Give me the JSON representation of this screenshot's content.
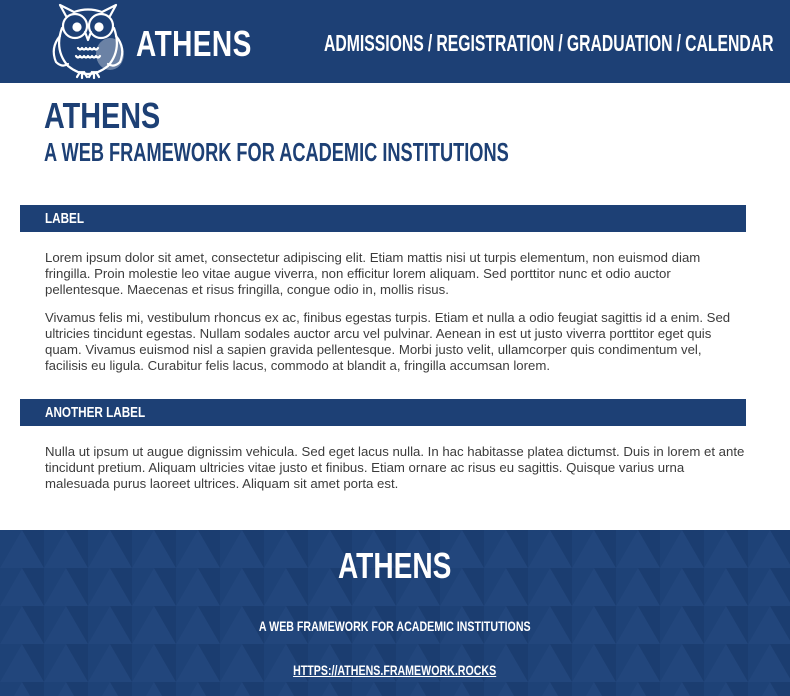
{
  "header": {
    "brand": "ATHENS",
    "nav": [
      {
        "label": "ADMISSIONS"
      },
      {
        "label": "REGISTRATION"
      },
      {
        "label": "GRADUATION"
      },
      {
        "label": "CALENDAR"
      }
    ],
    "nav_separator": "/"
  },
  "hero": {
    "title": "ATHENS",
    "subtitle": "A WEB FRAMEWORK FOR ACADEMIC INSTITUTIONS"
  },
  "sections": [
    {
      "label": "LABEL",
      "paragraphs": [
        "Lorem ipsum dolor sit amet, consectetur adipiscing elit. Etiam mattis nisi ut turpis elementum, non euismod diam fringilla. Proin molestie leo vitae augue viverra, non efficitur lorem aliquam. Sed porttitor nunc et odio auctor pellentesque. Maecenas et risus fringilla, congue odio in, mollis risus.",
        "Vivamus felis mi, vestibulum rhoncus ex ac, finibus egestas turpis. Etiam et nulla a odio feugiat sagittis id a enim. Sed ultricies tincidunt egestas. Nullam sodales auctor arcu vel pulvinar. Aenean in est ut justo viverra porttitor eget quis quam. Vivamus euismod nisl a sapien gravida pellentesque. Morbi justo velit, ullamcorper quis condimentum vel, facilisis eu ligula. Curabitur felis lacus, commodo at blandit a, fringilla accumsan lorem."
      ]
    },
    {
      "label": "ANOTHER LABEL",
      "paragraphs": [
        "Nulla ut ipsum ut augue dignissim vehicula. Sed eget lacus nulla. In hac habitasse platea dictumst. Duis in lorem et ante tincidunt pretium. Aliquam ultricies vitae justo et finibus. Etiam ornare ac risus eu sagittis. Quisque varius urna malesuada purus laoreet ultrices. Aliquam sit amet porta est."
      ]
    }
  ],
  "footer": {
    "title": "ATHENS",
    "subtitle": "A WEB FRAMEWORK FOR ACADEMIC INSTITUTIONS",
    "link": "HTTPS://ATHENS.FRAMEWORK.ROCKS"
  },
  "colors": {
    "primary": "#1d4075",
    "footer_pattern_light": "#24497f",
    "footer_pattern_dark": "#1a3b6d",
    "text": "#3c3c3c",
    "background": "#ffffff"
  },
  "icons": {
    "logo": "owl-logo-icon"
  }
}
